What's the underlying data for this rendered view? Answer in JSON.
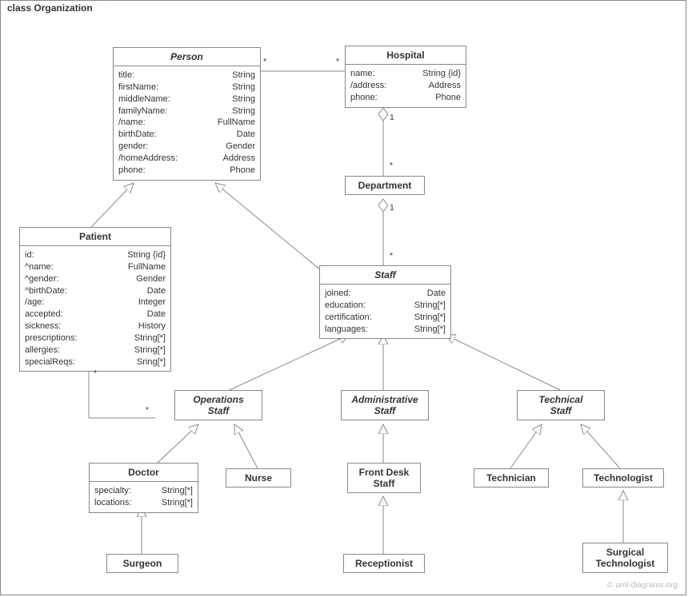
{
  "frame_label": "class Organization",
  "watermark": "© uml-diagrams.org",
  "classes": {
    "person": {
      "name": "Person",
      "attrs": [
        {
          "name": "title:",
          "type": "String"
        },
        {
          "name": "firstName:",
          "type": "String"
        },
        {
          "name": "middleName:",
          "type": "String"
        },
        {
          "name": "familyName:",
          "type": "String"
        },
        {
          "name": "/name:",
          "type": "FullName"
        },
        {
          "name": "birthDate:",
          "type": "Date"
        },
        {
          "name": "gender:",
          "type": "Gender"
        },
        {
          "name": "/homeAddress:",
          "type": "Address"
        },
        {
          "name": "phone:",
          "type": "Phone"
        }
      ]
    },
    "hospital": {
      "name": "Hospital",
      "attrs": [
        {
          "name": "name:",
          "type": "String {id}"
        },
        {
          "name": "/address:",
          "type": "Address"
        },
        {
          "name": "phone:",
          "type": "Phone"
        }
      ]
    },
    "department": {
      "name": "Department",
      "attrs": []
    },
    "patient": {
      "name": "Patient",
      "attrs": [
        {
          "name": "id:",
          "type": "String {id}"
        },
        {
          "name": "^name:",
          "type": "FullName"
        },
        {
          "name": "^gender:",
          "type": "Gender"
        },
        {
          "name": "^birthDate:",
          "type": "Date"
        },
        {
          "name": "/age:",
          "type": "Integer"
        },
        {
          "name": "accepted:",
          "type": "Date"
        },
        {
          "name": "sickness:",
          "type": "History"
        },
        {
          "name": "prescriptions:",
          "type": "String[*]"
        },
        {
          "name": "allergies:",
          "type": "String[*]"
        },
        {
          "name": "specialReqs:",
          "type": "Sring[*]"
        }
      ]
    },
    "staff": {
      "name": "Staff",
      "attrs": [
        {
          "name": "joined:",
          "type": "Date"
        },
        {
          "name": "education:",
          "type": "String[*]"
        },
        {
          "name": "certification:",
          "type": "String[*]"
        },
        {
          "name": "languages:",
          "type": "String[*]"
        }
      ]
    },
    "operationsStaff": {
      "name": "Operations\nStaff",
      "attrs": []
    },
    "adminStaff": {
      "name": "Administrative\nStaff",
      "attrs": []
    },
    "technicalStaff": {
      "name": "Technical\nStaff",
      "attrs": []
    },
    "doctor": {
      "name": "Doctor",
      "attrs": [
        {
          "name": "specialty:",
          "type": "String[*]"
        },
        {
          "name": "locations:",
          "type": "String[*]"
        }
      ]
    },
    "nurse": {
      "name": "Nurse",
      "attrs": []
    },
    "frontDesk": {
      "name": "Front Desk\nStaff",
      "attrs": []
    },
    "technician": {
      "name": "Technician",
      "attrs": []
    },
    "technologist": {
      "name": "Technologist",
      "attrs": []
    },
    "surgeon": {
      "name": "Surgeon",
      "attrs": []
    },
    "receptionist": {
      "name": "Receptionist",
      "attrs": []
    },
    "surgicalTech": {
      "name": "Surgical\nTechnologist",
      "attrs": []
    }
  },
  "multiplicities": {
    "ph1": "*",
    "ph2": "*",
    "hd1": "1",
    "hd2": "*",
    "ds1": "1",
    "ds2": "*",
    "po1": "*",
    "po2": "*"
  }
}
